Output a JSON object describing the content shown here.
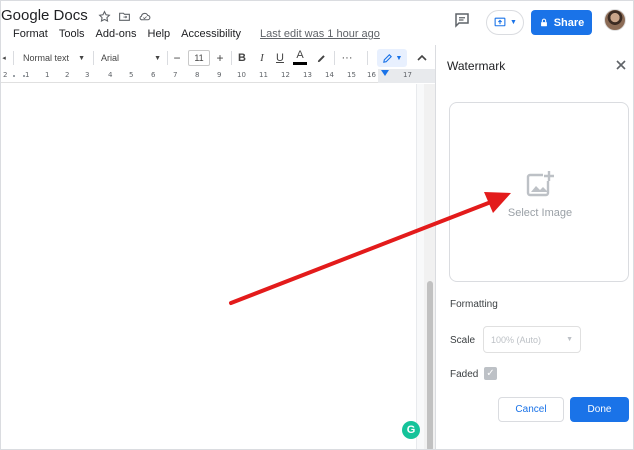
{
  "app": {
    "title": "Google Docs",
    "menu": [
      "Format",
      "Tools",
      "Add-ons",
      "Help",
      "Accessibility"
    ],
    "last_edit": "Last edit was 1 hour ago",
    "share_label": "Share"
  },
  "toolbar": {
    "style_value": "Normal text",
    "font_value": "Arial",
    "size_minus": "−",
    "size_value": "11",
    "size_plus": "+",
    "bold": "B",
    "italic": "I",
    "underline": "U",
    "text_color": "A",
    "more": "···"
  },
  "ruler": {
    "labels": [
      "2",
      "1",
      "1",
      "2",
      "3",
      "4",
      "5",
      "6",
      "7",
      "8",
      "9",
      "10",
      "11",
      "12",
      "13",
      "14",
      "15",
      "16",
      "17"
    ]
  },
  "panel": {
    "title": "Watermark",
    "select_image": "Select Image",
    "formatting": "Formatting",
    "scale_label": "Scale",
    "scale_value": "100% (Auto)",
    "faded_label": "Faded",
    "cancel": "Cancel",
    "done": "Done"
  },
  "grammarly": "G",
  "colors": {
    "accent": "#1a73e8",
    "annotation_arrow": "#e31b1b",
    "grammarly": "#15c39a"
  }
}
